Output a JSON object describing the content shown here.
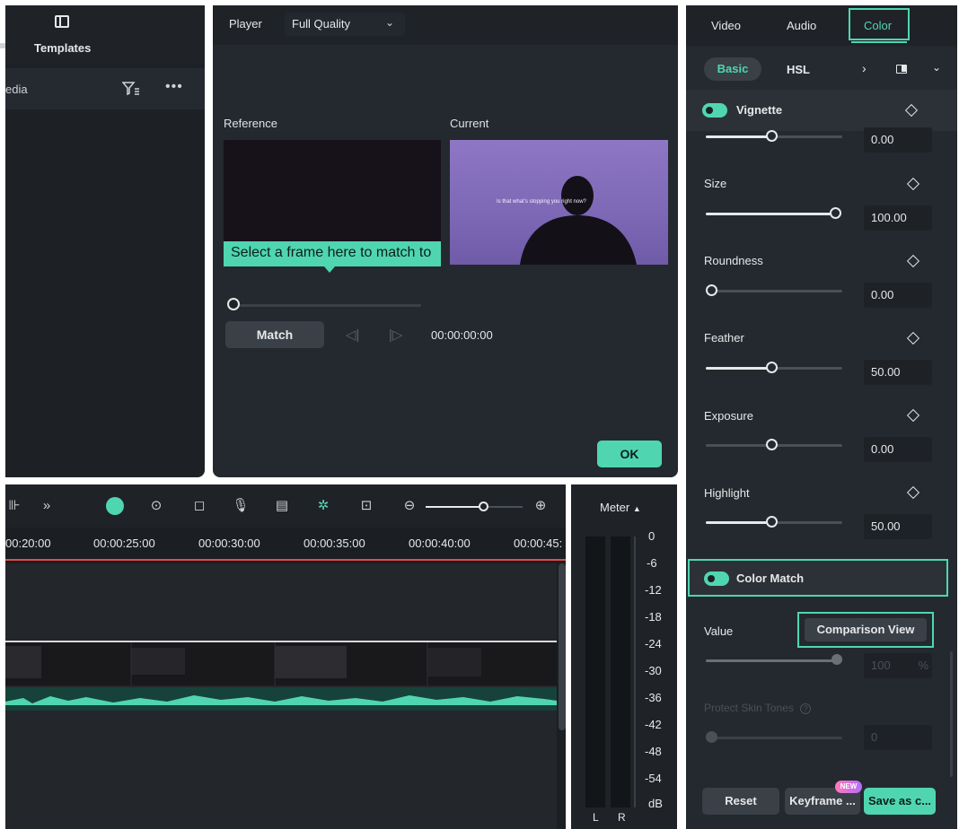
{
  "media_panel": {
    "tab_label": "Templates",
    "row_label": "edia"
  },
  "player": {
    "tab_label": "Player",
    "quality_label": "Full Quality",
    "reference_label": "Reference",
    "current_label": "Current",
    "frame_caption": "Is that what's stopping you right now?",
    "tooltip": "Select a frame here to match to",
    "match_button": "Match",
    "timecode": "00:00:00:00",
    "ok_button": "OK"
  },
  "right_panel": {
    "tabs": [
      "Video",
      "Audio",
      "Color"
    ],
    "active_tab": "Color",
    "subtabs": [
      "Basic",
      "HSL"
    ],
    "vignette_title": "Vignette",
    "params": [
      {
        "label": "",
        "value": "0.00",
        "fill": 0.5
      },
      {
        "label": "Size",
        "value": "100.00",
        "fill": 1.0
      },
      {
        "label": "Roundness",
        "value": "0.00",
        "fill": 0.0
      },
      {
        "label": "Feather",
        "value": "50.00",
        "fill": 0.5
      },
      {
        "label": "Exposure",
        "value": "0.00",
        "fill": 0.5
      },
      {
        "label": "Highlight",
        "value": "50.00",
        "fill": 0.5
      }
    ],
    "color_match_title": "Color Match",
    "value_label": "Value",
    "comparison_button": "Comparison View",
    "value_amount": "100",
    "value_unit": "%",
    "protect_label": "Protect Skin Tones",
    "protect_value": "0",
    "reset_button": "Reset",
    "keyframe_button": "Keyframe ...",
    "new_badge": "NEW",
    "save_button": "Save as c..."
  },
  "timeline": {
    "ruler": [
      "00:20:00",
      "00:00:25:00",
      "00:00:30:00",
      "00:00:35:00",
      "00:00:40:00",
      "00:00:45:"
    ]
  },
  "meter": {
    "title": "Meter",
    "scale": [
      "0",
      "-6",
      "-12",
      "-18",
      "-24",
      "-30",
      "-36",
      "-42",
      "-48",
      "-54",
      "dB"
    ],
    "left": "L",
    "right": "R"
  },
  "colors": {
    "accent": "#4fd6b0",
    "panel": "#24292f",
    "playhead": "#e04b4b"
  }
}
